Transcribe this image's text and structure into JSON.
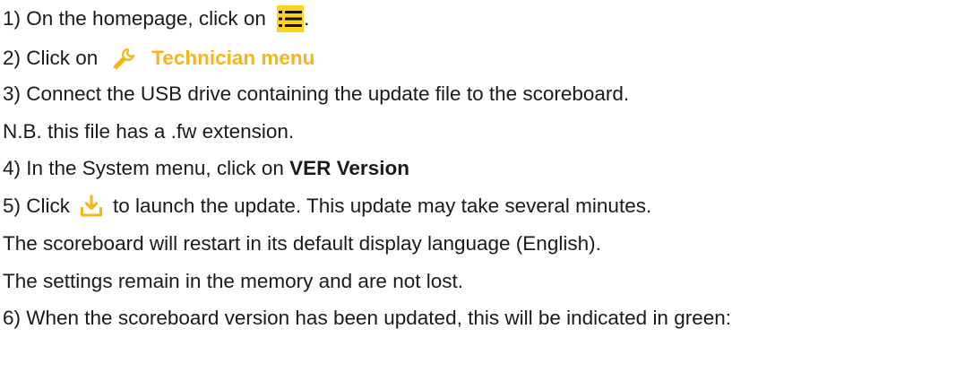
{
  "steps": {
    "s1": {
      "text": "1) On the homepage, click on ",
      "after": "."
    },
    "s2": {
      "text": "2) Click on",
      "highlight": "Technician menu"
    },
    "s3": {
      "text": "3) Connect the USB drive containing the update file to the scoreboard."
    },
    "s3_note": {
      "text": "N.B. this file has a .fw extension."
    },
    "s4": {
      "text": "4) In the System menu, click on ",
      "bold": "VER Version"
    },
    "s5": {
      "text": "5) Click",
      "after": "to launch the update. This update may take several minutes."
    },
    "s5_note1": {
      "text": "The scoreboard will restart in its default display language (English)."
    },
    "s5_note2": {
      "text": "The settings remain in the memory and are not lost."
    },
    "s6": {
      "text": "6) When the scoreboard version has been updated, this will be indicated in green:"
    }
  },
  "icons": {
    "menu": "menu-list-icon",
    "technician": "wrench-icon",
    "update": "download-icon"
  },
  "colors": {
    "accent_yellow": "#ffd21f",
    "technician_orange": "#f7b51b",
    "text": "#1a1a1a"
  }
}
